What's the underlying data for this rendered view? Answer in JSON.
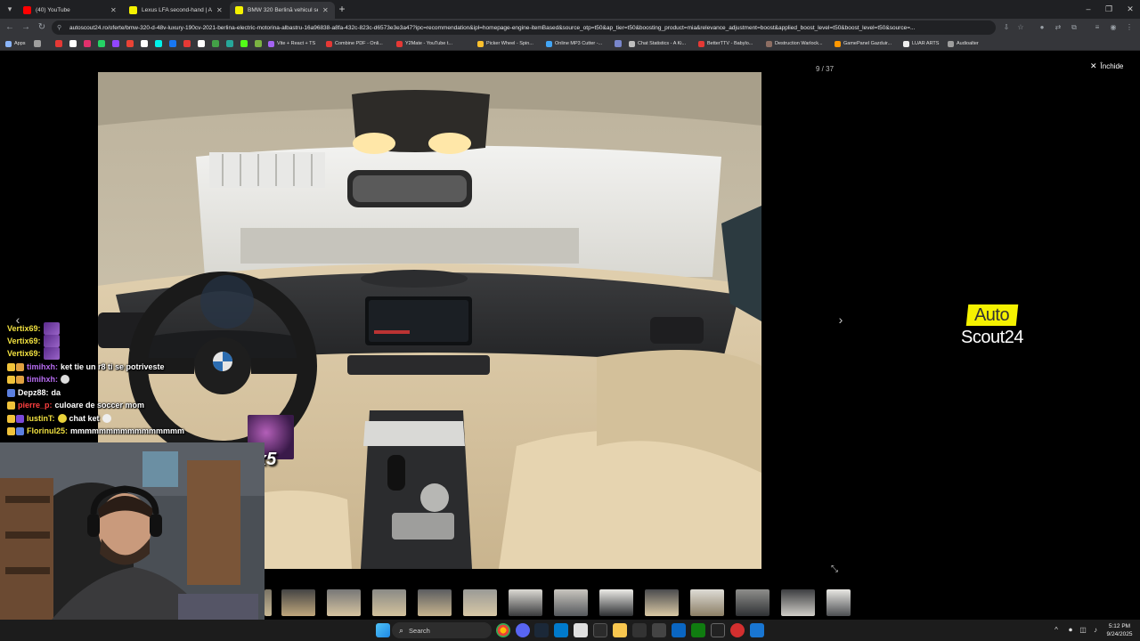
{
  "browser": {
    "tabs": [
      {
        "title": "(40) YouTube",
        "active": false,
        "favicon_color": "#ff0000"
      },
      {
        "title": "Lexus LFA second-hand | Autos...",
        "active": false,
        "favicon_color": "#f5f200"
      },
      {
        "title": "BMW 320 Berlină vehicul secon...",
        "active": true,
        "favicon_color": "#f5f200"
      }
    ],
    "new_tab_label": "+",
    "url": "autoscout24.ro/oferte/bmw-320-d-48v-luxury-190cv-2021-berlina-electric-motorina-albastru-16a96838-a8fa-432c-823c-d6573e3e3a47?ipc=recommendation&ipl=homepage-engine-itemBased&source_otp=t50&ap_tier=t50&boosting_product=mia&relevance_adjustment=boost&applied_boost_level=t50&boost_level=t50&source=...",
    "bookmarks": [
      {
        "label": "Apps",
        "color": "#8ab4f8"
      },
      {
        "label": "Vite + React + TS",
        "color": "#a463f2"
      },
      {
        "label": "Combine PDF - Onli...",
        "color": "#e53935"
      },
      {
        "label": "Y2Mate - YouTube t...",
        "color": "#e53935"
      },
      {
        "label": "Picker Wheel - Spin...",
        "color": "#fbc02d"
      },
      {
        "label": "Online MP3 Cutter -...",
        "color": "#42a5f5"
      },
      {
        "label": "Chat Statistics - A Ki...",
        "color": "#bdbdbd"
      },
      {
        "label": "BetterTTV - Babylo...",
        "color": "#e53935"
      },
      {
        "label": "Destruction Warlock...",
        "color": "#8d6e63"
      },
      {
        "label": "GamePanel Gazduir...",
        "color": "#ff9800"
      },
      {
        "label": "LUAR ARTS",
        "color": "#eeeeee"
      },
      {
        "label": "Audioalter",
        "color": "#9e9e9e"
      }
    ]
  },
  "gallery": {
    "counter": "9 / 37",
    "close_label": "Închide",
    "prev_label": "‹",
    "next_label": "›",
    "thumbnail_count": 14
  },
  "logo": {
    "line1": "Auto",
    "line2": "Scout24"
  },
  "stream_overlay": {
    "chat": [
      {
        "user": "Vertix69:",
        "user_color": "#f0e040",
        "message": "",
        "emote": true
      },
      {
        "user": "Vertix69:",
        "user_color": "#f0e040",
        "message": "",
        "emote": true
      },
      {
        "user": "Vertix69:",
        "user_color": "#f0e040",
        "message": "",
        "emote": true
      },
      {
        "user": "timihxh:",
        "user_color": "#b66bf0",
        "message": "ket tie un r8 ti se potriveste",
        "emote": false
      },
      {
        "user": "timihxh:",
        "user_color": "#b66bf0",
        "message": "",
        "emote": false
      },
      {
        "user": "Depz88:",
        "user_color": "#ffffff",
        "message": "da",
        "emote": false
      },
      {
        "user": "pierre_p:",
        "user_color": "#ff4040",
        "message": "culoare de soccer mom",
        "emote": false
      },
      {
        "user": "IustinT:",
        "user_color": "#f0e040",
        "message": "chat  ket",
        "emote": false
      },
      {
        "user": "Florinul25:",
        "user_color": "#f0e040",
        "message": "mmmmmmmmmmmmmmmm",
        "emote": false
      }
    ],
    "gift_multiplier": "x5"
  },
  "taskbar": {
    "search_label": "Search",
    "time": "5:12 PM",
    "date": "9/24/2025"
  }
}
